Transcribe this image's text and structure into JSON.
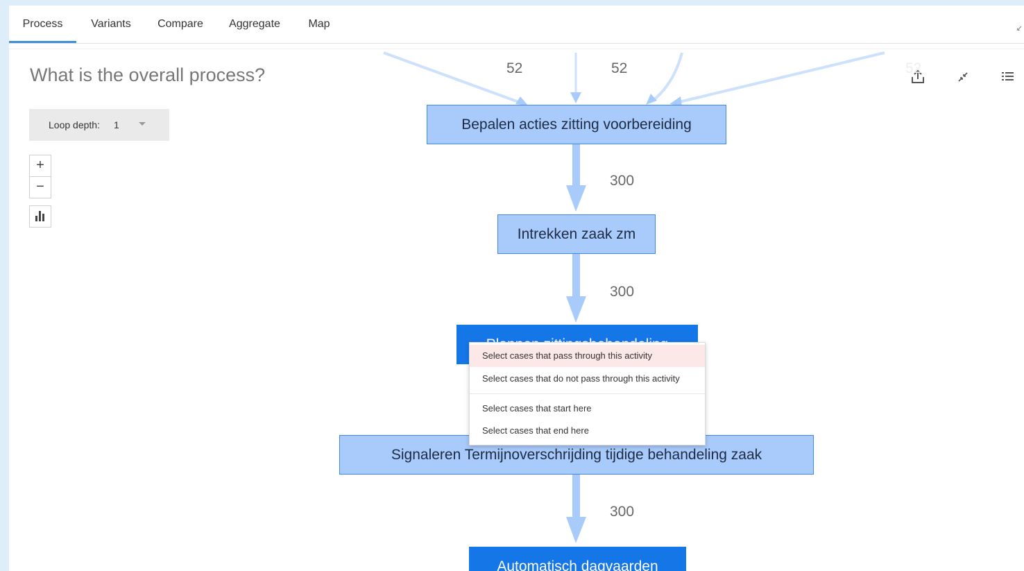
{
  "tabs": [
    {
      "label": "Process",
      "active": true
    },
    {
      "label": "Variants"
    },
    {
      "label": "Compare"
    },
    {
      "label": "Aggregate"
    },
    {
      "label": "Map"
    }
  ],
  "question": "What is the overall process?",
  "loop_depth": {
    "label": "Loop depth:",
    "value": "1"
  },
  "zoom": {
    "in": "+",
    "out": "−"
  },
  "toolbar_icons": [
    "share-icon",
    "collapse-icon",
    "list-icon",
    "bar-chart-icon"
  ],
  "colors": {
    "node": "#a9cbfb",
    "node_selected": "#1576e8",
    "edge": "#a9cbfb",
    "tab_active": "#3a8fd6"
  },
  "process_map": {
    "incoming_labels": [
      "52",
      "52",
      "52"
    ],
    "nodes": [
      {
        "label": "Bepalen acties zitting voorbereiding"
      },
      {
        "label": "Intrekken zaak zm"
      },
      {
        "label": "Plannen zittingsbehandeling"
      },
      {
        "label": "Signaleren Termijnoverschrijding tijdige behandeling zaak"
      },
      {
        "label": "Automatisch dagvaarden"
      }
    ],
    "edge_labels": [
      "300",
      "300",
      "300"
    ]
  },
  "context_menu": {
    "items": [
      "Select cases that pass through this activity",
      "Select cases that do not pass through this activity",
      "Select cases that start here",
      "Select cases that end here"
    ]
  }
}
